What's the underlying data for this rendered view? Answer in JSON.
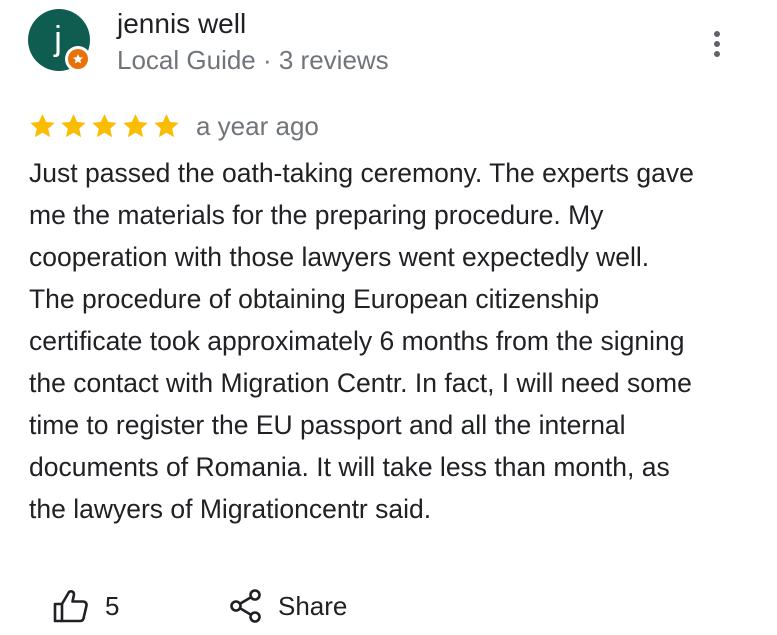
{
  "reviewer": {
    "initial": "j",
    "name": "jennis well",
    "meta": "Local Guide · 3 reviews",
    "avatar_color": "#0f5d50",
    "badge_color": "#e8710a"
  },
  "rating": {
    "stars": 5,
    "max": 5,
    "star_color": "#fbbc04",
    "date": "a year ago"
  },
  "review": {
    "lines": [
      "Just passed the oath-taking ceremony. The experts gave",
      "me the materials for the preparing procedure. My",
      "cooperation with those lawyers went expectedly well.",
      "The procedure of obtaining European citizenship",
      "certificate took approximately 6 months from the signing",
      "the contact with Migration Centr. In fact, I will need some",
      "time to register the EU passport and all the internal",
      "documents of Romania. It will take less than month, as",
      "the lawyers of Migrationcentr said."
    ]
  },
  "actions": {
    "like_count": "5",
    "share_label": "Share"
  },
  "icons": {
    "menu": "more-vert-icon",
    "like": "thumb-up-icon",
    "share": "share-icon",
    "badge": "local-guide-star-icon"
  }
}
